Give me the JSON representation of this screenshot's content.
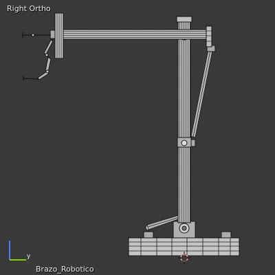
{
  "viewport": {
    "view_name": "Right Ortho",
    "object_name": "Brazo_Robotico",
    "axis_labels": {
      "horizontal": "y",
      "vertical": "z"
    },
    "colors": {
      "background": "#393939",
      "grid_line": "#404040",
      "mesh_fill": "#b4b4b4",
      "mesh_wire": "#1a1a1a",
      "axis_y": "#7fd000",
      "axis_z": "#4a7bff",
      "cursor_red": "#d23c3c"
    },
    "model": {
      "name": "robotic-arm",
      "shading": "wireframe-over-solid"
    }
  }
}
